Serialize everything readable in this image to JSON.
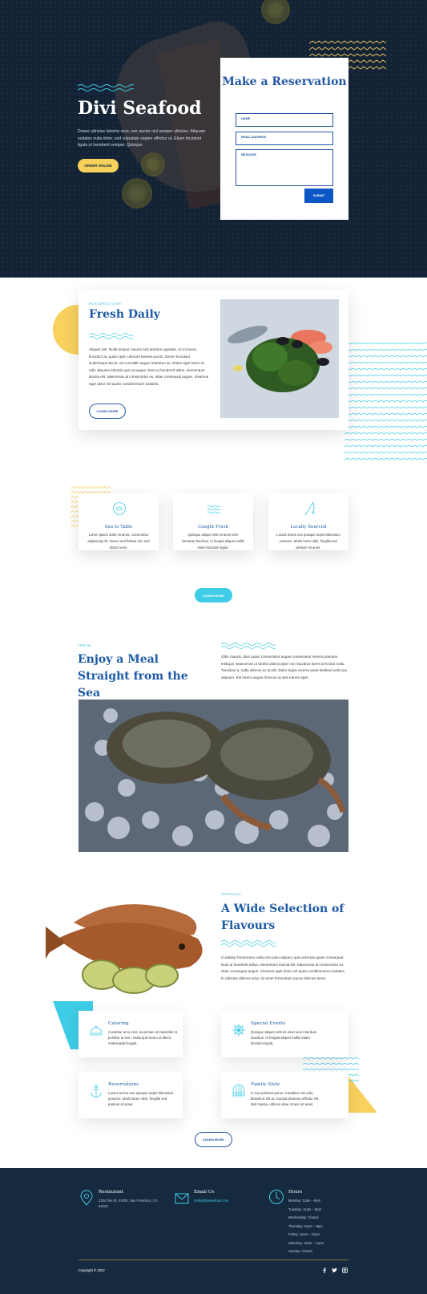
{
  "hero": {
    "title": "Divi Seafood",
    "text": "Donec ultricies lobortis eros, nec auctor nisl semper ultricies. Aliquam sodales nulla dolor, sed vulputate sapien efficitur ut. Etiam tincidunt ligula ut hendrerit semper. Quisque",
    "order_button": "ORDER ONLINE"
  },
  "reservation": {
    "title": "Make a Reservation",
    "name_placeholder": "NAME",
    "email_placeholder": "EMAIL ADDRESS",
    "message_placeholder": "MESSAGE",
    "submit": "SUBMIT"
  },
  "fresh": {
    "eyebrow": "FEATURED DISH",
    "title": "Fresh Daily",
    "text": "Aliquet nisl. Nulla tempor mauris sed pretium egestas. Ut mi lacus, tincidunt ac quam quis, ultricies laoreet purus. Donec tincidunt scelerisque lacus, vel convallis augue interdum ac. Etiam eget tortor ac odio aliquam lobortis quis at augue. Duis ut hendrerit tellus, elementum lacinia elit. Maecenas at consectetur ex, vitae consequat augue. Vivamus eget dolor vel quam condimentum sodales.",
    "button": "LEARN MORE"
  },
  "features": [
    {
      "title": "Sea to Table",
      "text": "Lorem ipsum dolor sit amet, consectetur adipiscing elit. Donec sed finibus nisi, sed dictum eros.",
      "icon": "fish-plate-icon"
    },
    {
      "title": "Caught Fresh",
      "text": "Quisque aliquet velit sit amet sem interdum faucibus. In feugiat aliquet mollis etiam tincidunt ligula.",
      "icon": "waves-icon"
    },
    {
      "title": "Locally Sourced",
      "text": "Luctus lectus non quisque turpis bibendum posuere. Morbi tortor nibh, fringilla sed pretium sit amet.",
      "icon": "fishing-rod-icon"
    }
  ],
  "features_button": "LEARN MORE",
  "meal": {
    "eyebrow": "FRESH",
    "title": "Enjoy a Meal Straight from the Sea",
    "text": "Odio mauris, duis quam consectetur augue consectetur viverra posuere tristique. Maecenas ut facilisi ullamcorper non faucibus lorem id lectus nulla. Tincidunt a, nulla ultrices ac at elit. Dolor turpis viverra amet eleifend velit non aliquam. Est lorem augue rhoncus at sed rutrum eget."
  },
  "services": {
    "eyebrow": "SERVICES",
    "title": "A Wide Selection of Flavours",
    "text": "Curabitur fermentum nulla non justo aliquet, quis vehicula quam consequat. Duis ut hendrerit tellus, elementum lacinia elit. Maecenas at consectetur ex, vitae consequat augue. Vivamus eget dolor vel quam condimentum sodales. In ultricies ultrices urna, sit amet fermentum purus ultricies amet.",
    "items": [
      {
        "title": "Catering",
        "text": "Curabitur arcu erat, accumsan id imperdiet et, porttitor at sem. Nulla quis lorem ut libero malesuada feugiat.",
        "icon": "cloche-icon"
      },
      {
        "title": "Special Events",
        "text": "Quisque aliquet velit sit amet sem interdum faucibus. In feugiat aliquet mollis etiam tincidunt ligula.",
        "icon": "ships-wheel-icon"
      },
      {
        "title": "Reservations",
        "text": "Luctus lectus non quisque turpis bibendum posuere. Morbi tortor nibh, fringilla sed pretium sit amet.",
        "icon": "anchor-icon"
      },
      {
        "title": "Family Style",
        "text": "In non pulvinar purus. Curabitur nisi odio, blandit et elit at, suscipit pharetra efficitur elit. Nisl massa, ultrices vitae ornare sit amet.",
        "icon": "net-icon"
      }
    ],
    "button": "LEARN MORE"
  },
  "footer": {
    "restaurant_title": "Restaurant",
    "restaurant_text": "1234 Divi St. #1000, San Francisco, CA 94220",
    "email_title": "Email Us",
    "email_text": "hello@diviseafood.com",
    "hours_title": "Hours",
    "hours": [
      "Monday: 11am – 9pm",
      "Tuesday: 11am – 9pm",
      "Wednesday: Closed",
      "Thursday: 11am – 9pm",
      "Friday: 11am – 11pm",
      "Saturday: 11am – 11pm",
      "Sunday: Closed"
    ],
    "copyright": "Copyright © 2022",
    "social": [
      "facebook-icon",
      "twitter-icon",
      "instagram-icon"
    ]
  },
  "colors": {
    "navy": "#132335",
    "blue": "#1c5aa6",
    "cyan": "#3ecce6",
    "yellow": "#f8d15e"
  }
}
